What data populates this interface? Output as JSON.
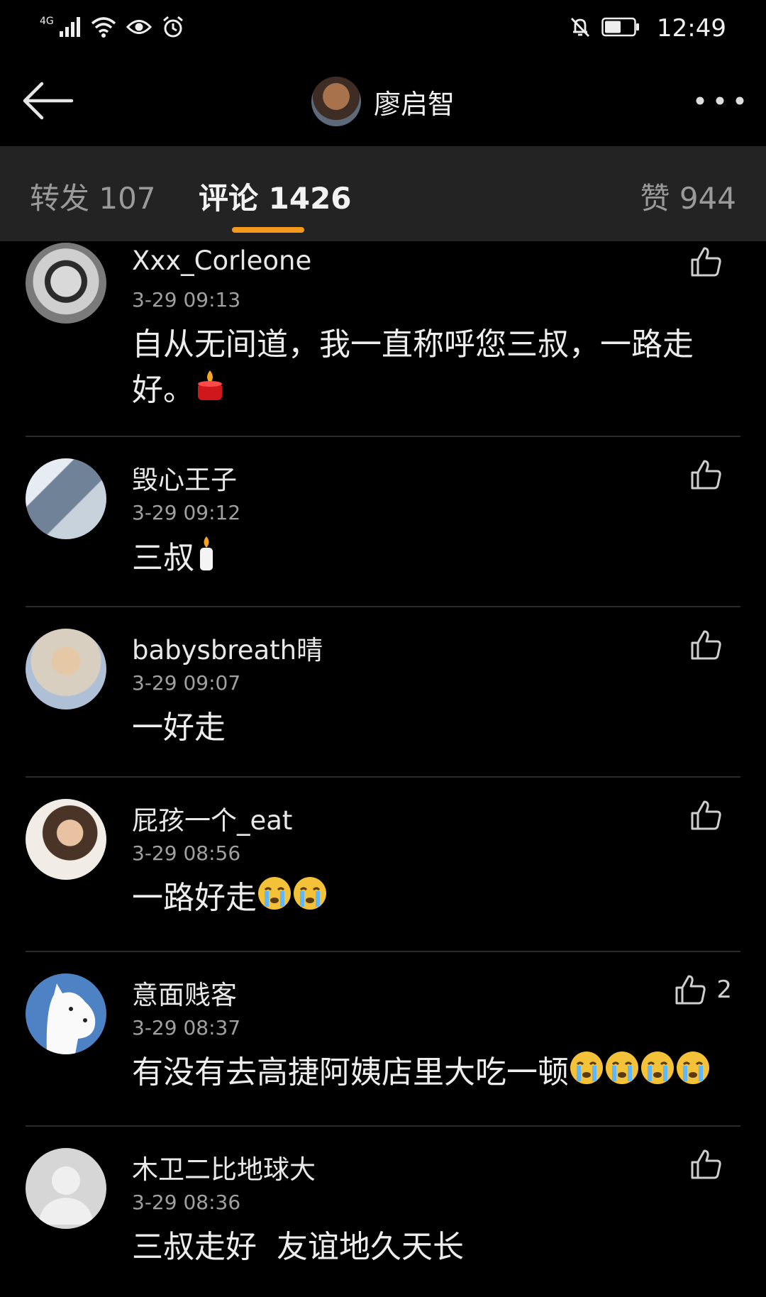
{
  "status_bar": {
    "network": "4G",
    "time": "12:49",
    "icons": [
      "signal-icon",
      "wifi-icon",
      "eye-icon",
      "alarm-icon",
      "mute-bell-icon",
      "battery-icon"
    ]
  },
  "header": {
    "title": "廖启智"
  },
  "tabs": [
    {
      "label": "转发 107"
    },
    {
      "label": "评论 1426"
    },
    {
      "label": "赞 944"
    }
  ],
  "colors": {
    "accent": "#f39a1e",
    "tab_bg": "#232323",
    "background": "#000000"
  },
  "comments": [
    {
      "user": "Xxx_Corleone",
      "time": "3-29 09:13",
      "text": "自从无间道，我一直称呼您三叔，一路走好。",
      "emoji": [
        "candle-red"
      ],
      "likes": ""
    },
    {
      "user": "毁心王子",
      "time": "3-29 09:12",
      "text": "三叔",
      "emoji": [
        "candle-white"
      ],
      "likes": ""
    },
    {
      "user": "babysbreath晴",
      "time": "3-29 09:07",
      "text": "一好走",
      "emoji": [],
      "likes": ""
    },
    {
      "user": "屁孩一个_eat",
      "time": "3-29 08:56",
      "text": "一路好走",
      "emoji": [
        "crying-face",
        "crying-face"
      ],
      "likes": ""
    },
    {
      "user": "意面贱客",
      "time": "3-29 08:37",
      "text": "有没有去高捷阿姨店里大吃一顿",
      "emoji": [
        "crying-face",
        "crying-face",
        "crying-face",
        "crying-face"
      ],
      "likes": "2"
    },
    {
      "user": "木卫二比地球大",
      "time": "3-29 08:36",
      "text": "三叔走好  友谊地久天长",
      "emoji": [],
      "likes": ""
    }
  ]
}
